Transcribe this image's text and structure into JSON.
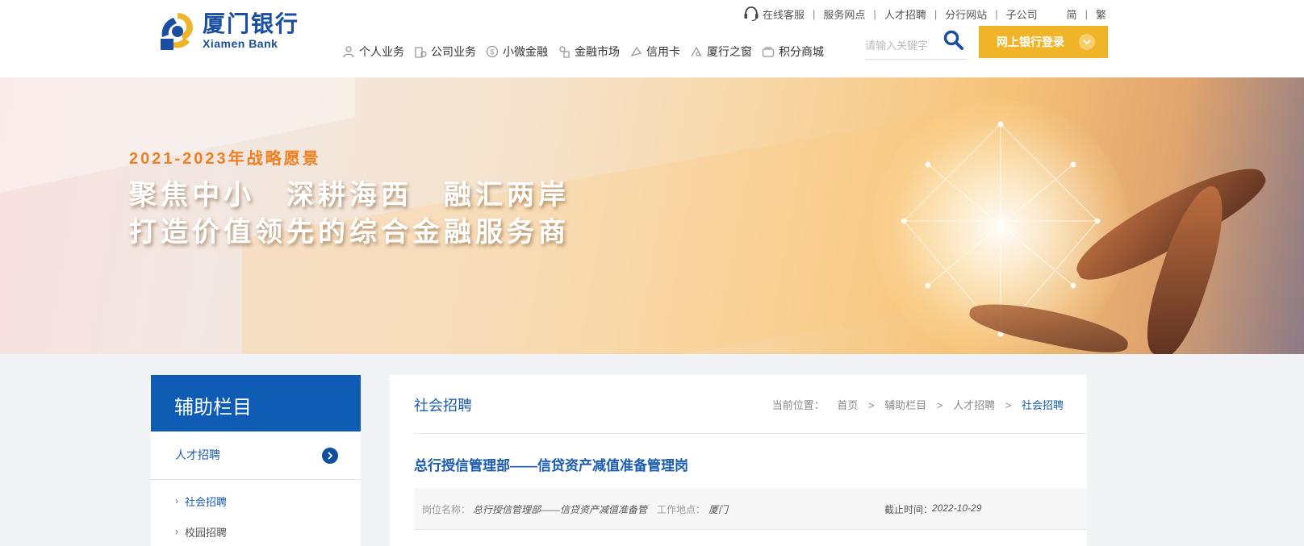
{
  "logo": {
    "cn": "厦门银行",
    "en": "Xiamen Bank"
  },
  "toplinks": [
    "在线客服",
    "服务网点",
    "人才招聘",
    "分行网站",
    "子公司"
  ],
  "lang": {
    "simplified": "简",
    "traditional": "繁"
  },
  "nav": [
    "个人业务",
    "公司业务",
    "小微金融",
    "金融市场",
    "信用卡",
    "厦行之窗",
    "积分商城"
  ],
  "search": {
    "placeholder": "请输入关键字"
  },
  "login": {
    "label": "网上银行登录"
  },
  "banner": {
    "subtitle": "2021-2023年战略愿景",
    "line1": "聚焦中小　深耕海西　融汇两岸",
    "line2": "打造价值领先的综合金融服务商"
  },
  "sidebar": {
    "title": "辅助栏目",
    "section": "人才招聘",
    "items": [
      "社会招聘",
      "校园招聘"
    ]
  },
  "content": {
    "title": "社会招聘",
    "breadcrumb": {
      "label": "当前位置：",
      "items": [
        "首页",
        "辅助栏目",
        "人才招聘",
        "社会招聘"
      ]
    },
    "job_title": "总行授信管理部——信贷资产减值准备管理岗",
    "meta": {
      "position_label": "岗位名称：",
      "position_value": "总行授信管理部——信贷资产减值准备管",
      "location_label": "工作地点：",
      "location_value": "厦门",
      "deadline_label": "截止时间：",
      "deadline_value": "2022-10-29"
    }
  },
  "colors": {
    "brand_blue": "#0f5cb5",
    "accent_gold": "#f0b429",
    "banner_orange": "#ee7f22"
  }
}
